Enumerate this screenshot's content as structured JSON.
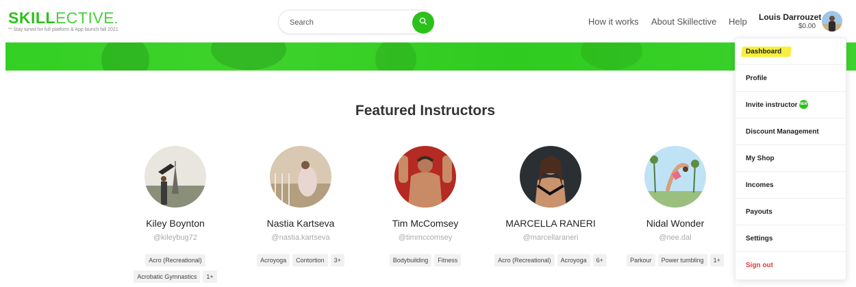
{
  "brand": {
    "logo_bold": "SKILL",
    "logo_light": "ECTIVE",
    "logo_dot": ".",
    "tagline": "** Stay tuned for full platform & App launch fall 2021"
  },
  "search": {
    "placeholder": "Search",
    "icon": "search-icon"
  },
  "nav": {
    "how_it_works": "How it works",
    "about": "About Skillective",
    "help": "Help"
  },
  "user": {
    "name": "Louis Darrouzet",
    "balance": "$0.00"
  },
  "main": {
    "section_title": "Featured Instructors"
  },
  "instructors": [
    {
      "name": "Kiley Boynton",
      "handle": "@kileybug72",
      "tags": [
        "Acro (Recreational)",
        "Acrobatic Gymnastics",
        "1+"
      ]
    },
    {
      "name": "Nastia Kartseva",
      "handle": "@nastia.kartseva",
      "tags": [
        "Acroyoga",
        "Contortion",
        "3+"
      ]
    },
    {
      "name": "Tim McComsey",
      "handle": "@timmccomsey",
      "tags": [
        "Bodybuilding",
        "Fitness"
      ]
    },
    {
      "name": "MARCELLA RANERI",
      "handle": "@marcellaraneri",
      "tags": [
        "Acro (Recreational)",
        "Acroyoga",
        "6+"
      ]
    },
    {
      "name": "Nidal Wonder",
      "handle": "@nee.dal",
      "tags": [
        "Parkour",
        "Power tumbling",
        "1+"
      ]
    }
  ],
  "dropdown": {
    "items": [
      {
        "label": "Dashboard"
      },
      {
        "label": "Profile"
      },
      {
        "label": "Invite instructor",
        "badge": "NEW"
      },
      {
        "label": "Discount Management"
      },
      {
        "label": "My Shop"
      },
      {
        "label": "Incomes"
      },
      {
        "label": "Payouts"
      },
      {
        "label": "Settings"
      },
      {
        "label": "Sign out"
      }
    ]
  },
  "colors": {
    "brand_green": "#2ac21a",
    "highlight_yellow": "#f7ef3c",
    "signout_red": "#e23b3b"
  }
}
